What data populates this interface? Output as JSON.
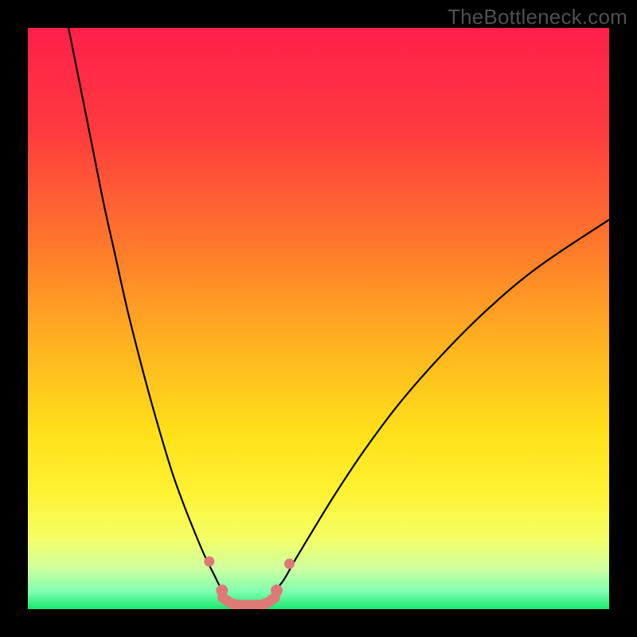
{
  "watermark": "TheBottleneck.com",
  "chart_data": {
    "type": "line",
    "title": "",
    "xlabel": "",
    "ylabel": "",
    "xlim": [
      0,
      100
    ],
    "ylim": [
      0,
      100
    ],
    "grid": false,
    "legend": false,
    "background_gradient_stops": [
      {
        "offset": 0.0,
        "color": "#ff1f4a"
      },
      {
        "offset": 0.18,
        "color": "#ff3b3e"
      },
      {
        "offset": 0.38,
        "color": "#ff7a2b"
      },
      {
        "offset": 0.55,
        "color": "#ffb41f"
      },
      {
        "offset": 0.7,
        "color": "#ffe11a"
      },
      {
        "offset": 0.8,
        "color": "#fff233"
      },
      {
        "offset": 0.88,
        "color": "#f3ff66"
      },
      {
        "offset": 0.93,
        "color": "#cfffa0"
      },
      {
        "offset": 0.97,
        "color": "#7effb0"
      },
      {
        "offset": 1.0,
        "color": "#17e86f"
      }
    ],
    "series": [
      {
        "name": "left-branch",
        "color": "#000000",
        "width": 2.2,
        "x": [
          7.0,
          9.0,
          11.0,
          13.0,
          15.0,
          17.0,
          19.0,
          21.0,
          23.0,
          25.0,
          27.0,
          29.0,
          30.5,
          32.0,
          33.0,
          34.0
        ],
        "y": [
          100.0,
          90.0,
          80.0,
          70.0,
          61.0,
          52.0,
          44.0,
          36.5,
          29.5,
          23.0,
          17.5,
          12.5,
          9.0,
          6.0,
          4.0,
          2.5
        ]
      },
      {
        "name": "right-branch",
        "color": "#000000",
        "width": 2.2,
        "x": [
          42.0,
          44.0,
          46.0,
          49.0,
          53.0,
          58.0,
          64.0,
          71.0,
          79.0,
          88.0,
          100.0
        ],
        "y": [
          2.5,
          5.0,
          8.5,
          13.5,
          20.0,
          27.5,
          35.5,
          43.5,
          51.5,
          59.0,
          67.0
        ]
      },
      {
        "name": "floor-band",
        "color": "#dd7a78",
        "width": 13,
        "linecap": "round",
        "x": [
          33.5,
          35.0,
          36.5,
          38.0,
          39.5,
          41.0,
          42.5
        ],
        "y": [
          2.0,
          1.0,
          0.7,
          0.7,
          0.7,
          1.0,
          2.0
        ]
      }
    ],
    "markers": [
      {
        "name": "left-dot-upper",
        "x": 31.2,
        "y": 8.2,
        "r": 6.5,
        "color": "#dd7a78"
      },
      {
        "name": "left-dot-lower",
        "x": 33.4,
        "y": 3.2,
        "r": 7.5,
        "color": "#dd7a78"
      },
      {
        "name": "right-dot-lower",
        "x": 42.8,
        "y": 3.2,
        "r": 7.5,
        "color": "#dd7a78"
      },
      {
        "name": "right-dot-upper",
        "x": 45.0,
        "y": 7.8,
        "r": 6.5,
        "color": "#dd7a78"
      }
    ]
  }
}
